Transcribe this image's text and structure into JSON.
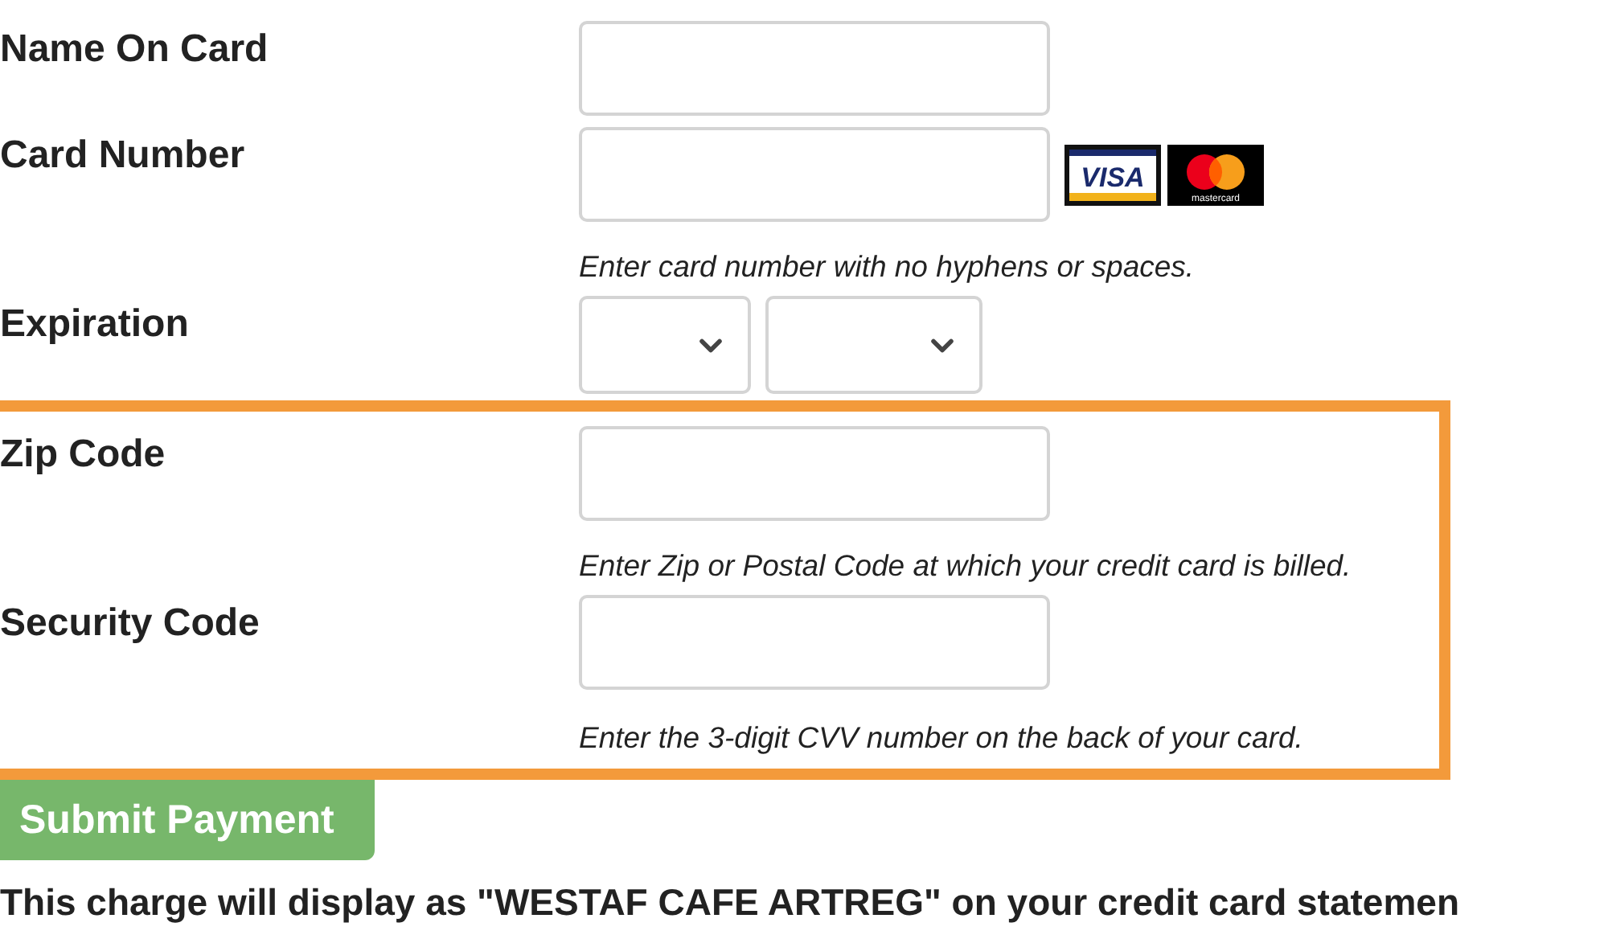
{
  "fields": [
    {
      "kind": "text",
      "label": "Name On Card"
    },
    {
      "kind": "text",
      "label": "Card Number",
      "hint": "Enter card number with no hyphens or spaces.",
      "logos": [
        {
          "kind": "visa",
          "text": "VISA"
        },
        {
          "kind": "mastercard",
          "text": "mastercard"
        }
      ]
    },
    {
      "kind": "expiration",
      "label": "Expiration",
      "selects": [
        {
          "kind": "month"
        },
        {
          "kind": "year"
        }
      ]
    }
  ],
  "highlight_box": {
    "color": "#f39a3b",
    "fields": [
      {
        "kind": "text",
        "label": "Zip Code",
        "hint": "Enter Zip or Postal Code at which your credit card is billed."
      },
      {
        "kind": "text",
        "label": "Security Code",
        "hint": "Enter the 3-digit CVV number on the back of your card."
      }
    ]
  },
  "submit_button": {
    "label": "Submit Payment"
  },
  "notice": "This charge will display as \"WESTAF CAFE ARTREG\" on your credit card statemen"
}
